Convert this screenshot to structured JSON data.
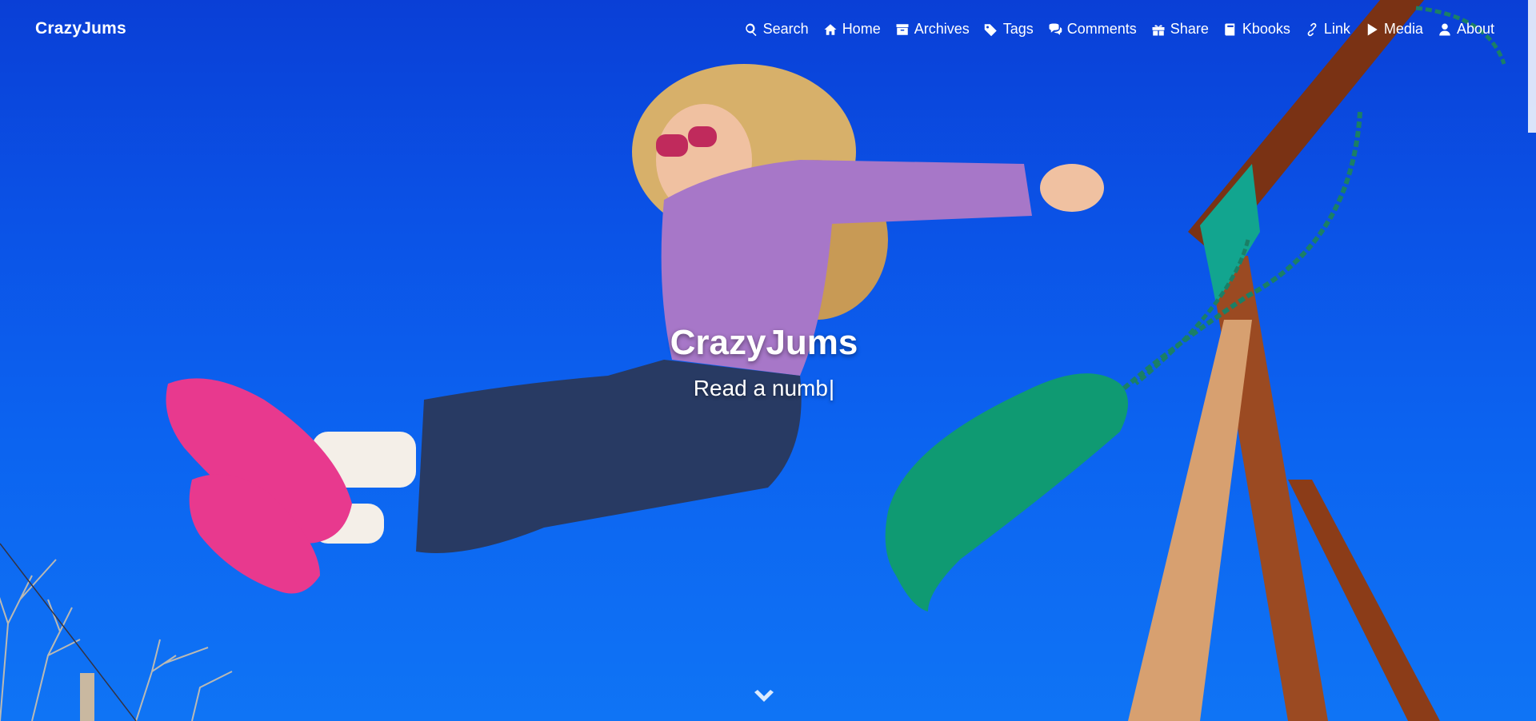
{
  "site": {
    "brand": "CrazyJums",
    "heading": "CrazyJums",
    "subheading": "Read a numb",
    "cursor": "|"
  },
  "nav": {
    "items": [
      {
        "label": "Search",
        "icon": "search-icon"
      },
      {
        "label": "Home",
        "icon": "home-icon"
      },
      {
        "label": "Archives",
        "icon": "archive-icon"
      },
      {
        "label": "Tags",
        "icon": "tags-icon"
      },
      {
        "label": "Comments",
        "icon": "comments-icon"
      },
      {
        "label": "Share",
        "icon": "gift-icon"
      },
      {
        "label": "Kbooks",
        "icon": "book-icon"
      },
      {
        "label": "Link",
        "icon": "link-icon"
      },
      {
        "label": "Media",
        "icon": "play-icon"
      },
      {
        "label": "About",
        "icon": "user-icon"
      }
    ]
  },
  "colors": {
    "sky": "#0b52e6",
    "text": "#ffffff"
  },
  "scroll_down_icon": "chevron-down-icon"
}
